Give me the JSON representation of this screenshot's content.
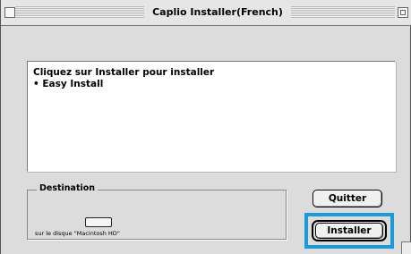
{
  "window": {
    "title": "Caplio Installer(French)"
  },
  "message": {
    "line1": "Cliquez sur Installer pour installer",
    "line2": "• Easy Install"
  },
  "destination": {
    "label": "Destination",
    "disk_caption": "sur le disque \"Macintosh HD\""
  },
  "buttons": {
    "quit": "Quitter",
    "install": "Installer"
  },
  "colors": {
    "highlight": "#1a9ad6"
  }
}
